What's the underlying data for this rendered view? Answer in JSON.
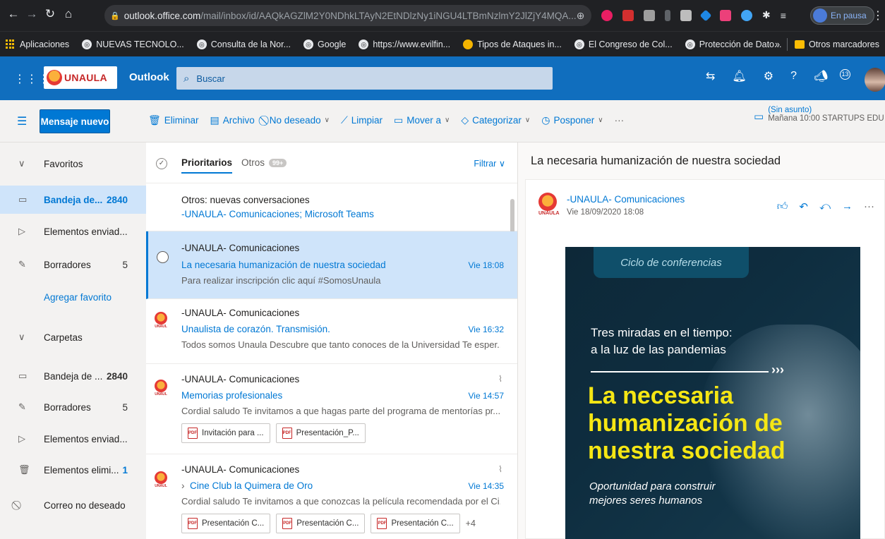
{
  "browser": {
    "url_host": "outlook.office.com",
    "url_path": "/mail/inbox/id/AAQkAGZlM2Y0NDhkLTAyN2EtNDlzNy1iNGU4LTBmNzlmY2JlZjY4MQA...",
    "pause_label": "En pausa",
    "bookmarks": [
      "Aplicaciones",
      "NUEVAS TECNOLO...",
      "Consulta de la Nor...",
      "Google",
      "https://www.evilfin...",
      "Tipos de Ataques in...",
      "El Congreso de Col...",
      "Protección de Dato..."
    ],
    "bookmarks_more": "»",
    "other_bookmarks": "Otros marcadores"
  },
  "header": {
    "logo_text": "UNAULA",
    "app_name": "Outlook",
    "search_placeholder": "Buscar",
    "notification_badge": "13",
    "brand_color": "#106ebe"
  },
  "commands": {
    "new_mail": "Mensaje nuevo",
    "delete": "Eliminar",
    "archive": "Archivo",
    "junk": "No deseado",
    "sweep": "Limpiar",
    "move": "Mover a",
    "categorize": "Categorizar",
    "snooze": "Posponer",
    "more": "···",
    "reminder_title": "(Sin asunto)",
    "reminder_detail": "Mañana 10:00 STARTUPS EDU"
  },
  "nav": {
    "favorites": "Favoritos",
    "inbox_fav": "Bandeja de...",
    "inbox_fav_count": "2840",
    "sent_fav": "Elementos enviad...",
    "drafts_fav": "Borradores",
    "drafts_fav_count": "5",
    "add_favorite": "Agregar favorito",
    "folders": "Carpetas",
    "inbox": "Bandeja de ...",
    "inbox_count": "2840",
    "drafts": "Borradores",
    "drafts_count": "5",
    "sent": "Elementos enviad...",
    "deleted": "Elementos elimi...",
    "deleted_count": "1",
    "junk": "Correo no deseado"
  },
  "list": {
    "tab_focused": "Prioritarios",
    "tab_other": "Otros",
    "other_badge": "99+",
    "filter": "Filtrar",
    "other_notice_title": "Otros: nuevas conversaciones",
    "other_notice_senders": "-UNAULA- Comunicaciones; Microsoft Teams",
    "messages": [
      {
        "sender": "-UNAULA- Comunicaciones",
        "subject": "La necesaria humanización de nuestra sociedad",
        "time": "Vie 18:08",
        "preview": "Para realizar inscripción clic aquí #SomosUnaula"
      },
      {
        "sender": "-UNAULA- Comunicaciones",
        "subject": "Unaulista de corazón. Transmisión.",
        "time": "Vie 16:32",
        "preview": "Todos somos Unaula Descubre que tanto conoces de la Universidad Te esper..."
      },
      {
        "sender": "-UNAULA- Comunicaciones",
        "subject": "Memorias profesionales",
        "time": "Vie 14:57",
        "preview": "Cordial saludo Te invitamos a que hagas parte del programa de mentorías pr...",
        "attachments": [
          "Invitación para ...",
          "Presentación_P..."
        ]
      },
      {
        "sender": "-UNAULA- Comunicaciones",
        "subject": "Cine Club la Quimera de Oro",
        "time": "Vie 14:35",
        "preview": "Cordial saludo Te invitamos a que conozcas la película recomendada por el Ci...",
        "attachments": [
          "Presentación C...",
          "Presentación C...",
          "Presentación C..."
        ],
        "more_attachments": "+4"
      }
    ]
  },
  "reading": {
    "subject": "La necesaria humanización de nuestra sociedad",
    "sender": "-UNAULA- Comunicaciones",
    "date": "Vie 18/09/2020 18:08",
    "banner": {
      "tag": "Ciclo de conferencias",
      "line1": "Tres miradas en el tiempo:",
      "line2": "a la luz de las pandemias",
      "arrows": "›››",
      "big1": "La necesaria",
      "big2": "humanización de",
      "big3": "nuestra sociedad",
      "sub1": "Oportunidad para construir",
      "sub2": "mejores seres humanos"
    }
  }
}
